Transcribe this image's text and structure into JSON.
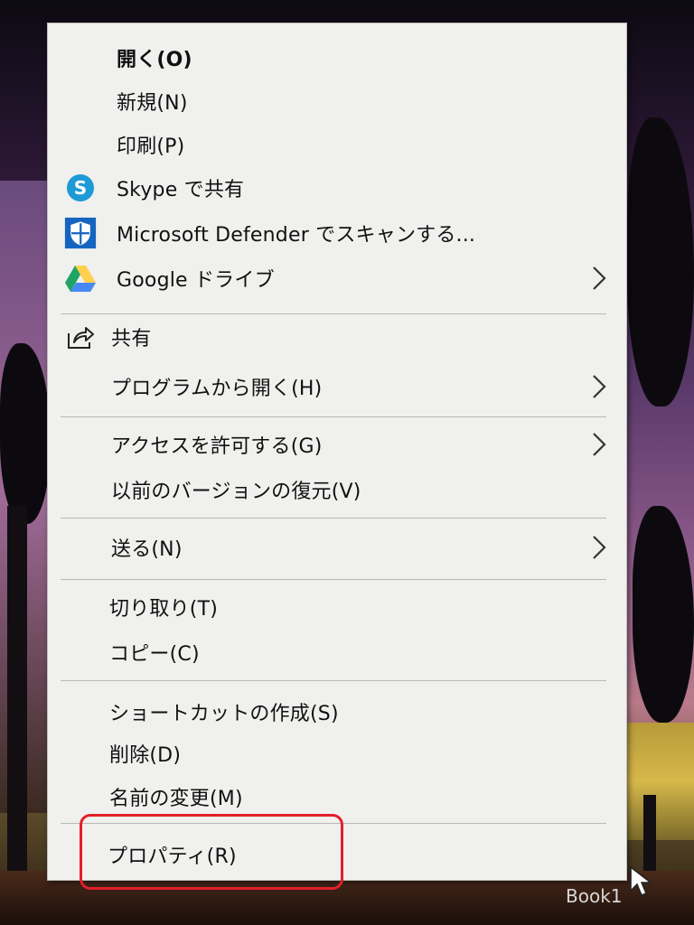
{
  "context_menu": {
    "items": [
      {
        "label": "開く(O)",
        "bold": true,
        "icon": null,
        "submenu": false
      },
      {
        "label": "新規(N)",
        "bold": false,
        "icon": null,
        "submenu": false
      },
      {
        "label": "印刷(P)",
        "bold": false,
        "icon": null,
        "submenu": false
      },
      {
        "label": "Skype で共有",
        "bold": false,
        "icon": "skype-icon",
        "submenu": false
      },
      {
        "label": "Microsoft Defender でスキャンする...",
        "bold": false,
        "icon": "defender-shield-icon",
        "submenu": false
      },
      {
        "label": "Google ドライブ",
        "bold": false,
        "icon": "google-drive-icon",
        "submenu": true
      },
      {
        "label": "共有",
        "bold": false,
        "icon": "share-icon",
        "submenu": false
      },
      {
        "label": "プログラムから開く(H)",
        "bold": false,
        "icon": null,
        "submenu": true
      },
      {
        "label": "アクセスを許可する(G)",
        "bold": false,
        "icon": null,
        "submenu": true
      },
      {
        "label": "以前のバージョンの復元(V)",
        "bold": false,
        "icon": null,
        "submenu": false
      },
      {
        "label": "送る(N)",
        "bold": false,
        "icon": null,
        "submenu": true
      },
      {
        "label": "切り取り(T)",
        "bold": false,
        "icon": null,
        "submenu": false
      },
      {
        "label": "コピー(C)",
        "bold": false,
        "icon": null,
        "submenu": false
      },
      {
        "label": "ショートカットの作成(S)",
        "bold": false,
        "icon": null,
        "submenu": false
      },
      {
        "label": "削除(D)",
        "bold": false,
        "icon": null,
        "submenu": false
      },
      {
        "label": "名前の変更(M)",
        "bold": false,
        "icon": null,
        "submenu": false
      },
      {
        "label": "プロパティ(R)",
        "bold": false,
        "icon": null,
        "submenu": false
      }
    ]
  },
  "desktop": {
    "file_label": "Book1"
  },
  "annotation": {
    "highlight_color": "#e21f2a",
    "highlighted_item": "プロパティ(R)"
  },
  "colors": {
    "skype_blue": "#1e9ad6",
    "defender_blue": "#1565c0",
    "drive_green": "#1fa463",
    "drive_yellow": "#ffd04b",
    "drive_blue": "#4688f4"
  }
}
